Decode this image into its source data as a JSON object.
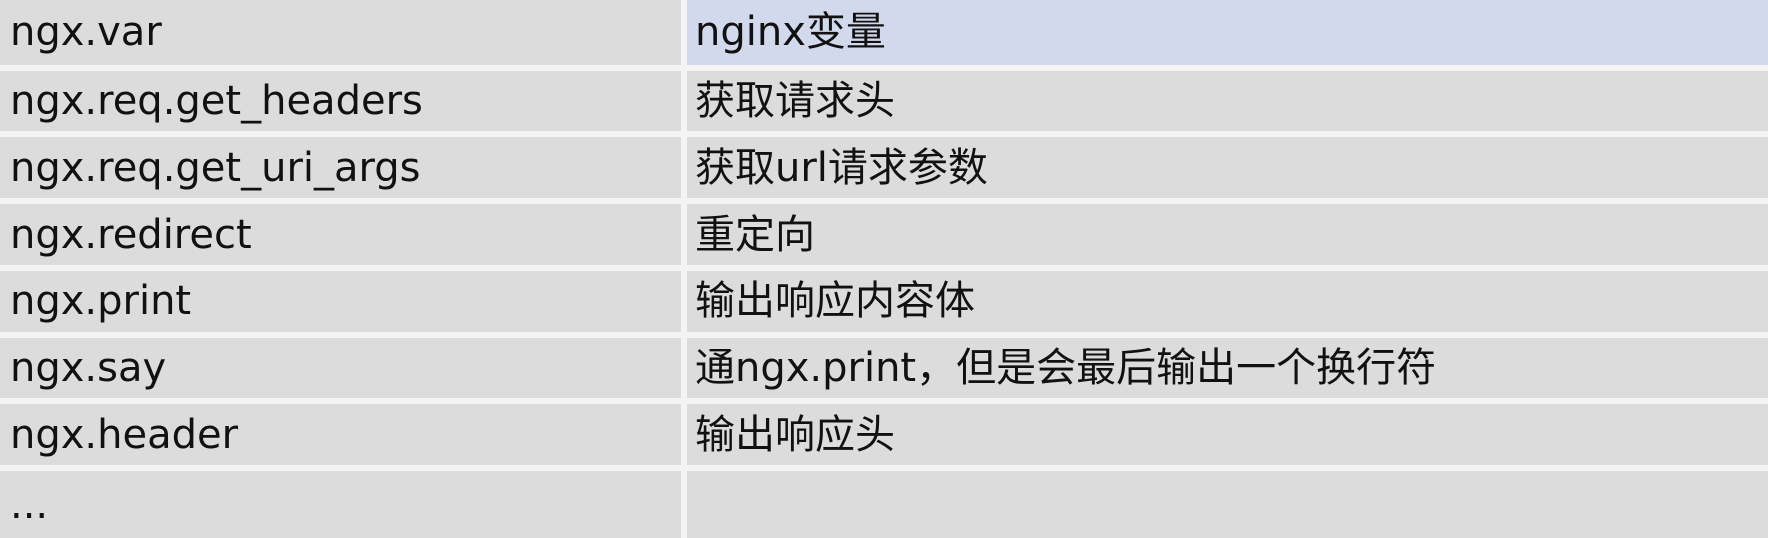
{
  "table": {
    "rows": [
      {
        "name": "ngx.var",
        "desc": "nginx变量"
      },
      {
        "name": "ngx.req.get_headers",
        "desc": "获取请求头"
      },
      {
        "name": "ngx.req.get_uri_args",
        "desc": "获取url请求参数"
      },
      {
        "name": "ngx.redirect",
        "desc": "重定向"
      },
      {
        "name": "ngx.print",
        "desc": "输出响应内容体"
      },
      {
        "name": "ngx.say",
        "desc": "通ngx.print，但是会最后输出一个换行符"
      },
      {
        "name": "ngx.header",
        "desc": "输出响应头"
      },
      {
        "name": "...",
        "desc": ""
      }
    ],
    "highlight_color": "#d3d9ec",
    "cell_color": "#dcdcdc"
  }
}
